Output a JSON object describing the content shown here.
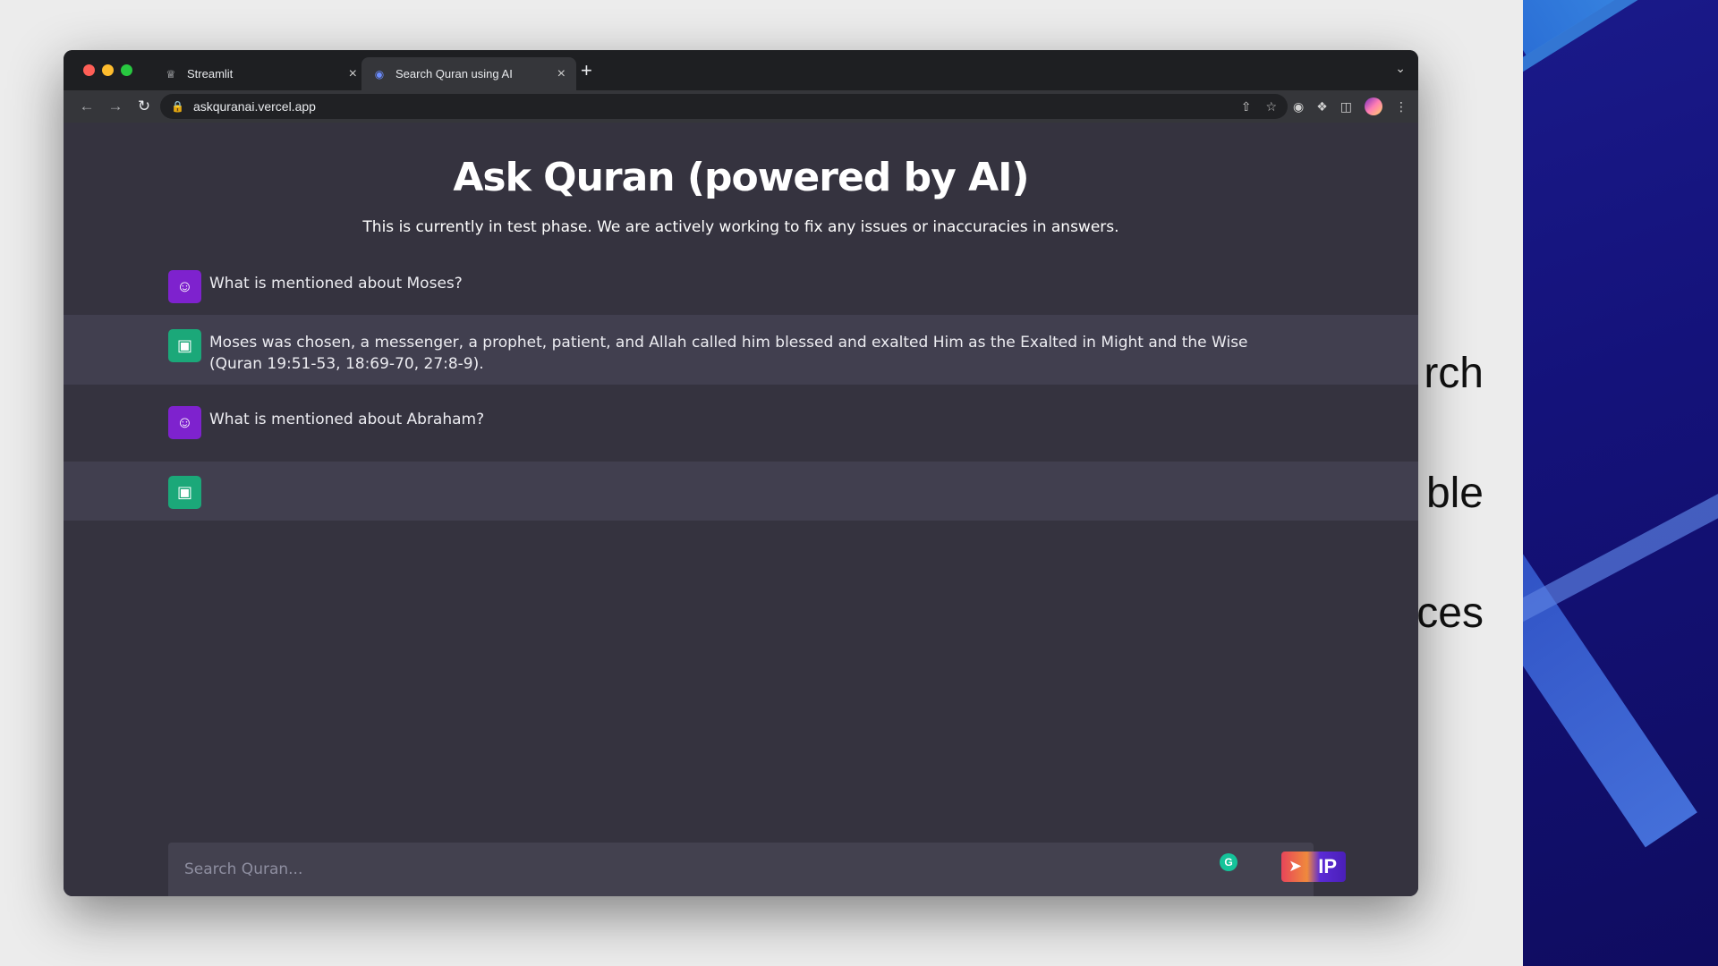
{
  "background_words": [
    "rch",
    "ble",
    "ces"
  ],
  "browser": {
    "tabs": [
      {
        "label": "Streamlit",
        "favicon": "streamlit-icon",
        "active": false
      },
      {
        "label": "Search Quran using AI",
        "favicon": "brain-icon",
        "active": true
      }
    ],
    "url": "askquranai.vercel.app"
  },
  "page": {
    "title": "Ask Quran (powered by AI)",
    "subtitle": "This is currently in test phase. We are actively working to fix any issues or inaccuracies in answers.",
    "messages": [
      {
        "role": "user",
        "text": "What is mentioned about Moses?"
      },
      {
        "role": "assistant",
        "text": " Moses was chosen, a messenger, a prophet, patient, and Allah called him blessed and exalted Him as the Exalted in Might and the Wise (Quran 19:51-53, 18:69-70, 27:8-9)."
      },
      {
        "role": "user",
        "text": "What is mentioned about Abraham?"
      },
      {
        "role": "assistant",
        "text": ""
      }
    ],
    "search_placeholder": "Search Quran...",
    "send_button_label": "IP"
  },
  "colors": {
    "page_bg": "#35333f",
    "assistant_row_bg": "#413f4f",
    "user_avatar": "#7e22ce",
    "assistant_avatar": "#1ba879"
  }
}
